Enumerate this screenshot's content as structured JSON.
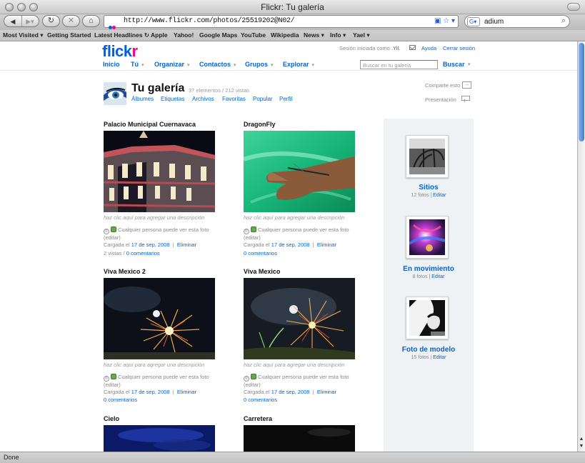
{
  "window": {
    "title": "Flickr: Tu galería"
  },
  "browser": {
    "url": "http://www.flickr.com/photos/25519202@N02/",
    "search_value": "adium",
    "status": "Done",
    "bookmarks": [
      "Most Visited ▾",
      "Getting Started",
      "Latest Headlines ↻",
      "Apple",
      "Yahoo!",
      "Google Maps",
      "YouTube",
      "Wikipedia",
      "News ▾",
      "Info ▾",
      "Yael ▾"
    ]
  },
  "header": {
    "logo_main": "flick",
    "logo_accent": "r",
    "signed_in_prefix": "Sesión iniciada como",
    "signed_in_user": ".Yil.",
    "help": "Ayuda",
    "sign_out": "Cerrar sesión",
    "menu": [
      {
        "label": "Inicio",
        "dropdown": false
      },
      {
        "label": "Tú",
        "dropdown": true
      },
      {
        "label": "Organizar",
        "dropdown": true
      },
      {
        "label": "Contactos",
        "dropdown": true
      },
      {
        "label": "Grupos",
        "dropdown": true
      },
      {
        "label": "Explorar",
        "dropdown": true
      }
    ],
    "search_placeholder": "Buscar en tu galería",
    "search_button": "Buscar"
  },
  "gallery": {
    "title": "Tu galería",
    "counts": "37 elementos / 212 vistas",
    "subnav": [
      "Álbumes",
      "Etiquetas",
      "Archivos",
      "Favoritas",
      "Popular",
      "Perfil"
    ],
    "share": "Comparte esto",
    "slideshow": "Presentación"
  },
  "photos": [
    {
      "title": "Palacio Municipal Cuernavaca",
      "desc": "haz clic aquí para agregar una descripción",
      "privacy": "Cualquier persona puede ver esta foto",
      "edit": "(editar)",
      "uploaded": "Cargada el",
      "date": "17 de sep, 2008",
      "delete": "Eliminar",
      "views": "2 vistas /",
      "comments": "0 comentarios"
    },
    {
      "title": "DragonFly",
      "desc": "haz clic aquí para agregar una descripción",
      "privacy": "Cualquier persona puede ver esta foto",
      "edit": "(editar)",
      "uploaded": "Cargada el",
      "date": "17 de sep, 2008",
      "delete": "Eliminar",
      "views": "",
      "comments": "0 comentarios"
    },
    {
      "title": "Viva Mexico 2",
      "desc": "haz clic aquí para agregar una descripción",
      "privacy": "Cualquier persona puede ver esta foto",
      "edit": "(editar)",
      "uploaded": "Cargada el",
      "date": "17 de sep, 2008",
      "delete": "Eliminar",
      "views": "",
      "comments": "0 comentarios"
    },
    {
      "title": "Viva Mexico",
      "desc": "haz clic aquí para agregar una descripción",
      "privacy": "Cualquier persona puede ver esta foto",
      "edit": "(editar)",
      "uploaded": "Cargada el",
      "date": "17 de sep, 2008",
      "delete": "Eliminar",
      "views": "",
      "comments": "0 comentarios"
    },
    {
      "title": "Cielo"
    },
    {
      "title": "Carretera"
    }
  ],
  "sets": [
    {
      "title": "Sitios",
      "count": "12 fotos",
      "edit": "Editar"
    },
    {
      "title": "En movimiento",
      "count": "8 fotos",
      "edit": "Editar"
    },
    {
      "title": "Foto de modelo",
      "count": "15 fotos",
      "edit": "Editar"
    }
  ],
  "colors": {
    "flickr_blue": "#0063dc",
    "flickr_pink": "#ff0084"
  },
  "icons": [
    "back-arrow-icon",
    "forward-arrow-icon",
    "reload-icon",
    "stop-icon",
    "home-icon",
    "rss-icon",
    "bookmark-star-icon",
    "search-icon",
    "mail-icon",
    "share-icon",
    "slideshow-icon",
    "creative-commons-icon",
    "public-icon"
  ]
}
